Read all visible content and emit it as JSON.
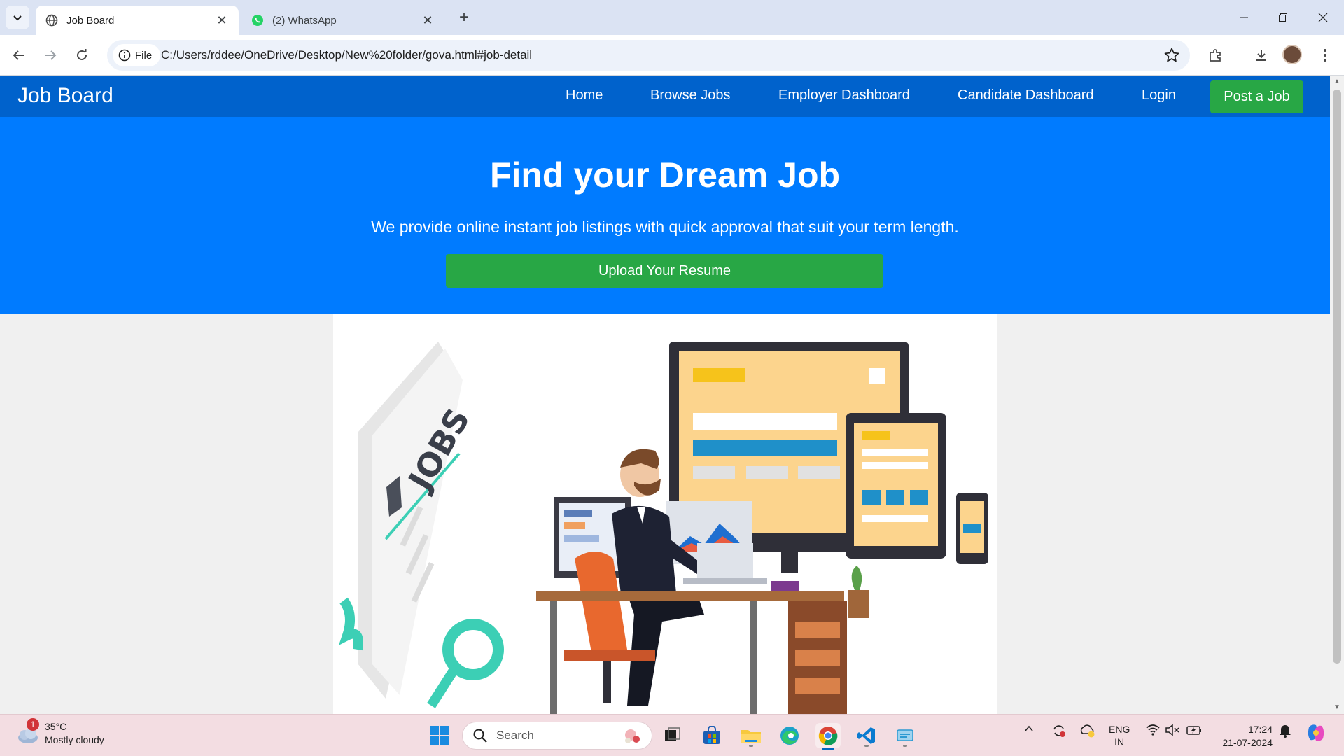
{
  "browser": {
    "tabs": [
      {
        "title": "Job Board",
        "active": true,
        "icon": "globe-icon"
      },
      {
        "title": "(2) WhatsApp",
        "active": false,
        "icon": "whatsapp-icon"
      }
    ],
    "new_tab_symbol": "+",
    "site_chip_label": "File",
    "url": "C:/Users/rddee/OneDrive/Desktop/New%20folder/gova.html#job-detail"
  },
  "page": {
    "brand": "Job Board",
    "nav": {
      "home": "Home",
      "browse_jobs": "Browse Jobs",
      "employer_dashboard": "Employer Dashboard",
      "candidate_dashboard": "Candidate Dashboard",
      "login": "Login",
      "post_job": "Post a Job"
    },
    "hero": {
      "title": "Find your Dream Job",
      "subtitle": "We provide online instant job listings with quick approval that suit your term length.",
      "cta": "Upload Your Resume"
    },
    "illustration": {
      "sign_text": "JOBS"
    }
  },
  "taskbar": {
    "weather": {
      "badge": "1",
      "temp": "35°C",
      "condition": "Mostly cloudy"
    },
    "search_placeholder": "Search",
    "lang_line1": "ENG",
    "lang_line2": "IN",
    "time": "17:24",
    "date": "21-07-2024"
  },
  "colors": {
    "navbar": "#0062cc",
    "hero": "#007bff",
    "button_green": "#28a745",
    "taskbar": "#f3dde2"
  }
}
